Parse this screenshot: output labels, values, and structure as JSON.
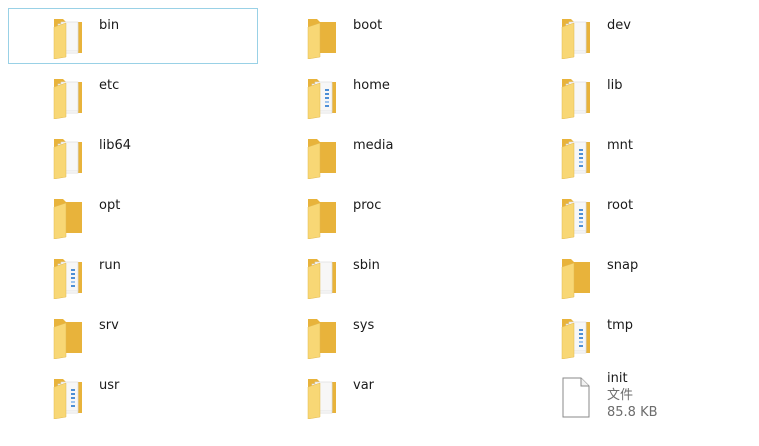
{
  "folders": [
    {
      "name": "bin",
      "selected": true,
      "variant": "docs"
    },
    {
      "name": "boot",
      "variant": "plain"
    },
    {
      "name": "dev",
      "variant": "docs"
    },
    {
      "name": "etc",
      "variant": "docs"
    },
    {
      "name": "home",
      "variant": "docs-blue"
    },
    {
      "name": "lib",
      "variant": "docs"
    },
    {
      "name": "lib64",
      "variant": "docs"
    },
    {
      "name": "media",
      "variant": "plain"
    },
    {
      "name": "mnt",
      "variant": "docs-blue"
    },
    {
      "name": "opt",
      "variant": "plain"
    },
    {
      "name": "proc",
      "variant": "plain"
    },
    {
      "name": "root",
      "variant": "docs-blue"
    },
    {
      "name": "run",
      "variant": "docs-blue"
    },
    {
      "name": "sbin",
      "variant": "docs"
    },
    {
      "name": "snap",
      "variant": "plain"
    },
    {
      "name": "srv",
      "variant": "plain"
    },
    {
      "name": "sys",
      "variant": "plain"
    },
    {
      "name": "tmp",
      "variant": "docs-blue"
    },
    {
      "name": "usr",
      "variant": "docs-blue"
    },
    {
      "name": "var",
      "variant": "docs"
    }
  ],
  "file": {
    "name": "init",
    "type": "文件",
    "size": "85.8 KB"
  },
  "colors": {
    "folder_back": "#e8b33b",
    "folder_front": "#f8d775",
    "selection_border": "#99d1e6",
    "doc_blue": "#4d8fd6"
  }
}
